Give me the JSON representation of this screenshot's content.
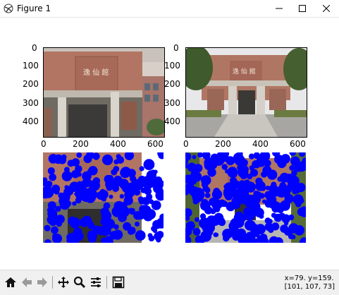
{
  "window": {
    "title": "Figure 1",
    "app_icon": "matplotlib-figure-icon",
    "controls": [
      "minimize-icon",
      "maximize-icon",
      "close-icon"
    ]
  },
  "figure": {
    "top_left": {
      "y_ticks": [
        "0",
        "100",
        "200",
        "300",
        "400"
      ],
      "x_ticks": [
        "0",
        "200",
        "400",
        "600"
      ]
    },
    "top_right": {
      "y_ticks": [
        "0",
        "100",
        "200",
        "300",
        "400"
      ],
      "x_ticks": [
        "0",
        "200",
        "400",
        "600"
      ]
    }
  },
  "toolbar": {
    "buttons": [
      "home-icon",
      "back-icon",
      "forward-icon",
      "pan-icon",
      "zoom-icon",
      "configure-subplots-icon",
      "save-icon"
    ]
  },
  "status": {
    "coords": "x=79. y=159.",
    "pixel": "[101, 107, 73]"
  },
  "colors": {
    "mask_color": "#0000ff",
    "brick": "#b07560"
  }
}
